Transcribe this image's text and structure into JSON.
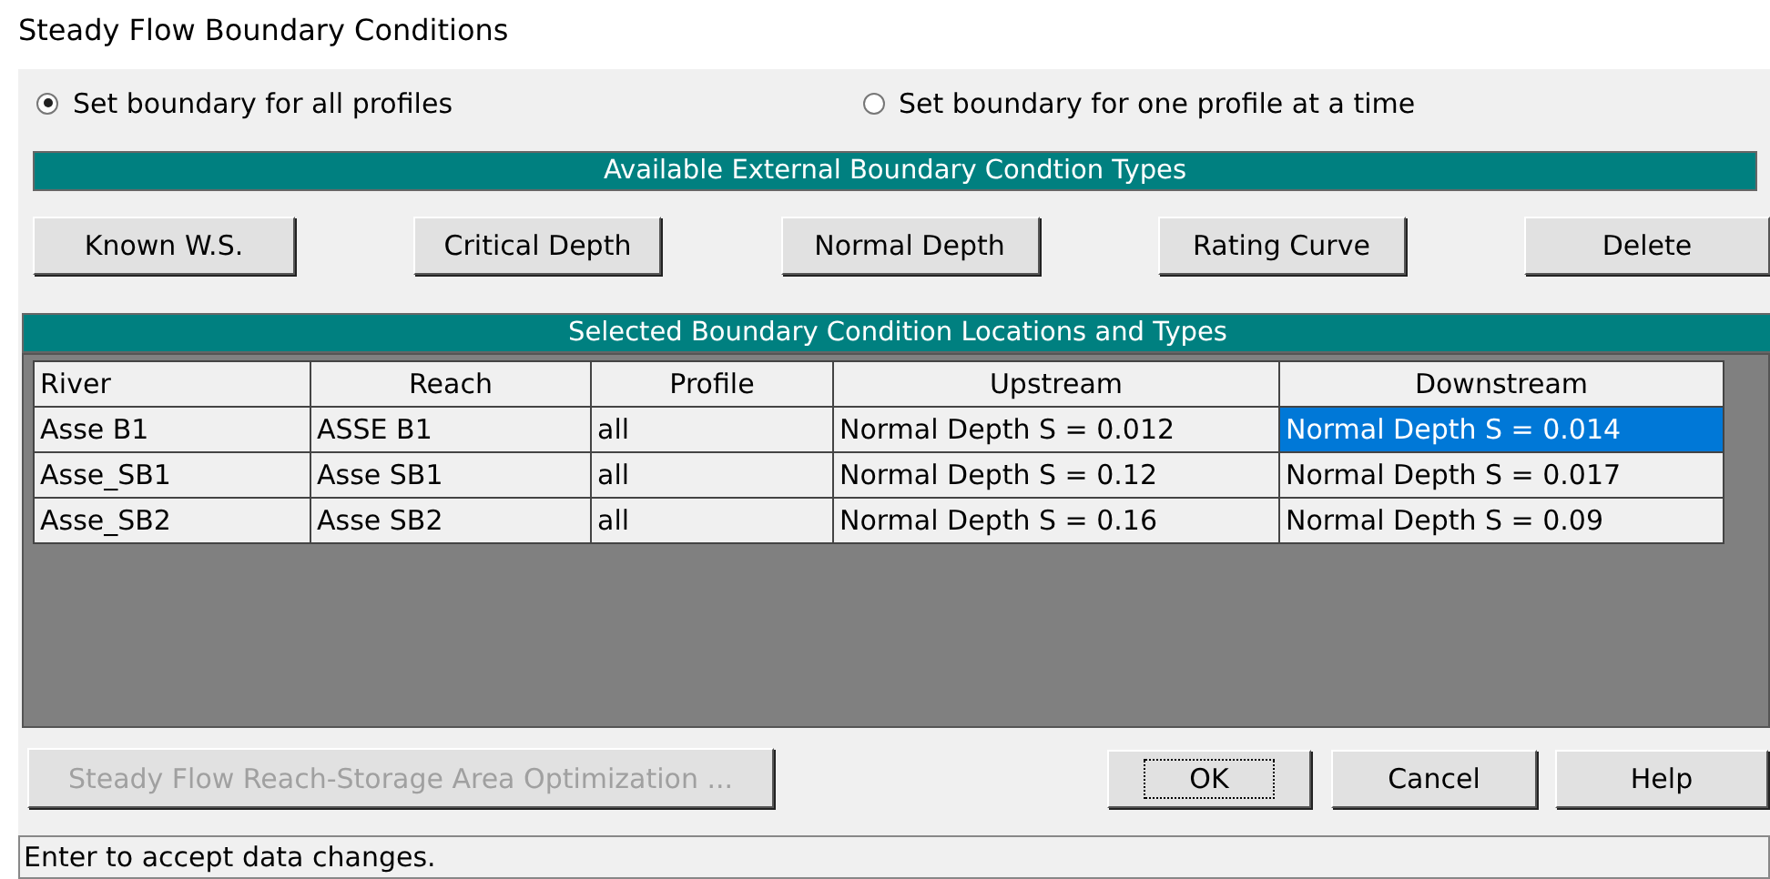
{
  "window": {
    "title": "Steady Flow Boundary Conditions"
  },
  "mode_options": [
    {
      "label": "Set boundary for all profiles",
      "selected": true
    },
    {
      "label": "Set boundary for one profile at a time",
      "selected": false
    }
  ],
  "types_header": "Available External Boundary Condtion Types",
  "type_buttons": [
    "Known W.S.",
    "Critical Depth",
    "Normal Depth",
    "Rating Curve",
    "Delete"
  ],
  "table": {
    "title": "Selected Boundary Condition Locations and Types",
    "columns": [
      "River",
      "Reach",
      "Profile",
      "Upstream",
      "Downstream"
    ],
    "rows": [
      {
        "cells": [
          {
            "text": "Asse B1",
            "selected": false
          },
          {
            "text": "ASSE B1",
            "selected": false
          },
          {
            "text": "all",
            "selected": false
          },
          {
            "text": "Normal Depth S = 0.012",
            "selected": false
          },
          {
            "text": "Normal Depth S = 0.014",
            "selected": true
          }
        ]
      },
      {
        "cells": [
          {
            "text": "Asse_SB1",
            "selected": false
          },
          {
            "text": "Asse SB1",
            "selected": false
          },
          {
            "text": "all",
            "selected": false
          },
          {
            "text": "Normal Depth S = 0.12",
            "selected": false
          },
          {
            "text": "Normal Depth S = 0.017",
            "selected": false
          }
        ]
      },
      {
        "cells": [
          {
            "text": "Asse_SB2",
            "selected": false
          },
          {
            "text": "Asse SB2",
            "selected": false
          },
          {
            "text": "all",
            "selected": false
          },
          {
            "text": "Normal Depth S = 0.16",
            "selected": false
          },
          {
            "text": "Normal Depth S = 0.09",
            "selected": false
          }
        ]
      }
    ]
  },
  "optimization_button": {
    "label": "Steady Flow Reach-Storage Area Optimization ...",
    "disabled": true
  },
  "dialog_buttons": [
    {
      "label": "OK",
      "focused": true
    },
    {
      "label": "Cancel",
      "focused": false
    },
    {
      "label": "Help",
      "focused": false
    }
  ],
  "status_bar": "Enter to accept data changes."
}
